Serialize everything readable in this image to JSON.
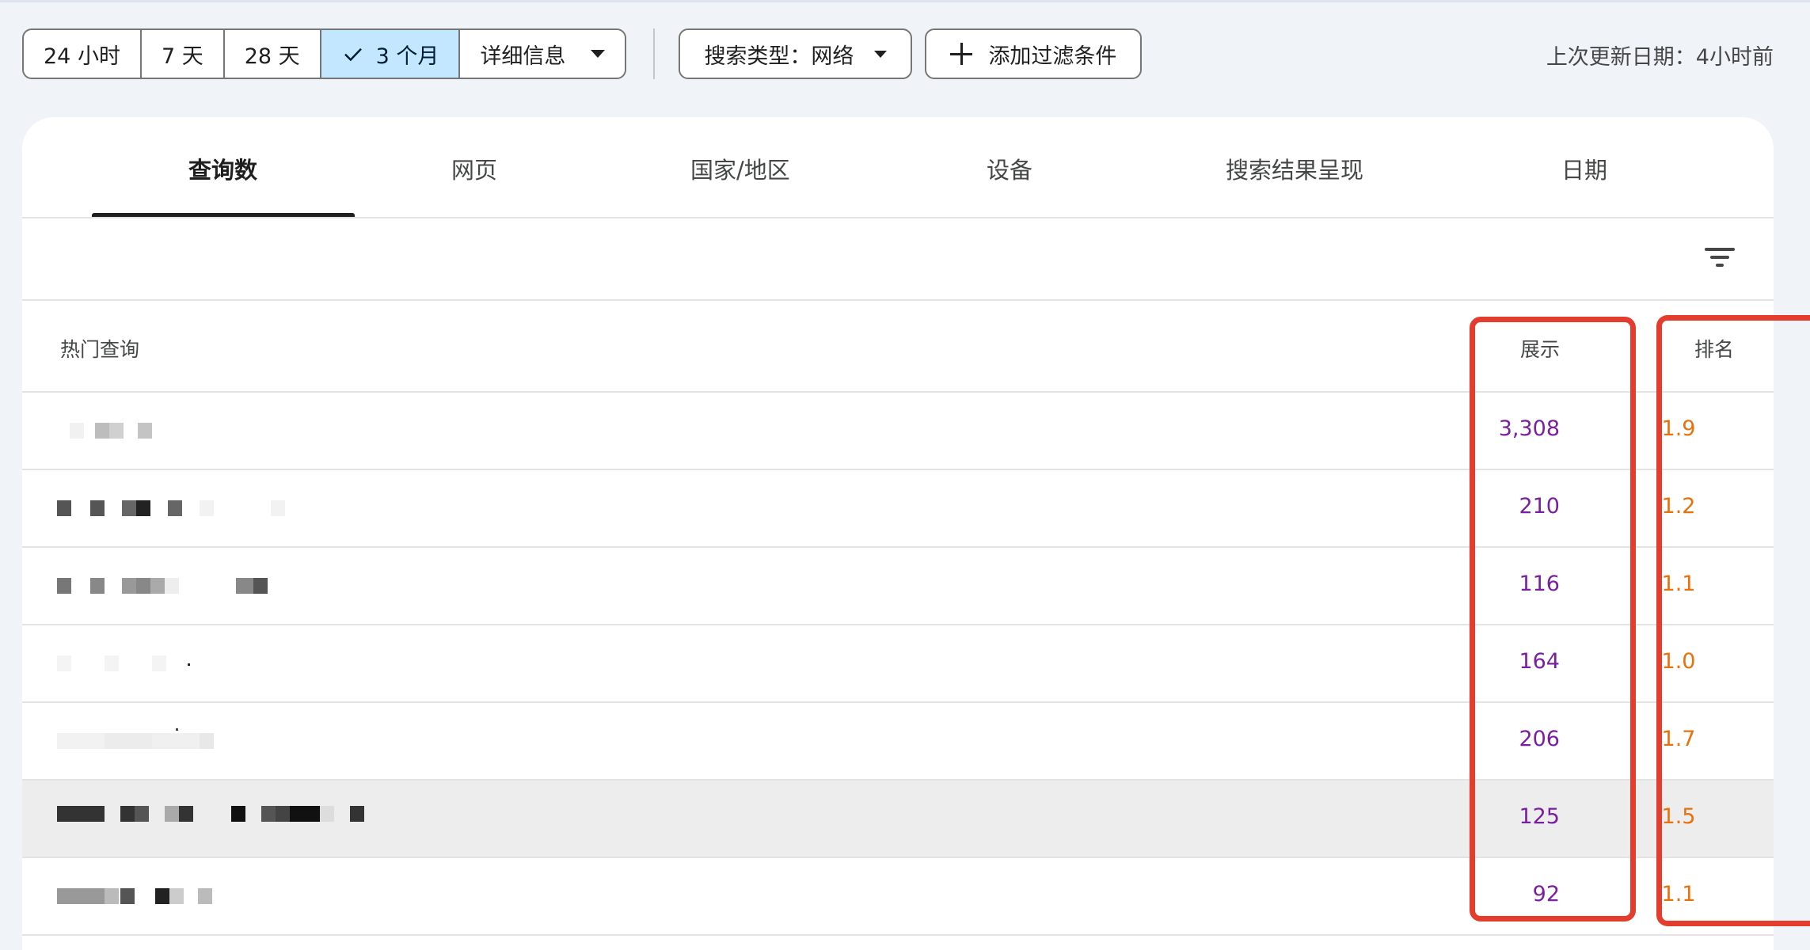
{
  "date_range": {
    "options": [
      "24 小时",
      "7 天",
      "28 天",
      "3 个月",
      "详细信息"
    ],
    "selected": "3 个月"
  },
  "search_type": {
    "label": "搜索类型：网络"
  },
  "add_filter": {
    "label": "添加过滤条件"
  },
  "last_updated": "上次更新日期：4小时前",
  "tabs": [
    {
      "label": "查询数",
      "active": true
    },
    {
      "label": "网页"
    },
    {
      "label": "国家/地区"
    },
    {
      "label": "设备"
    },
    {
      "label": "搜索结果呈现"
    },
    {
      "label": "日期"
    }
  ],
  "table": {
    "columns": {
      "query": "热门查询",
      "impressions": "展示",
      "position": "排名"
    },
    "rows": [
      {
        "impressions": "3,308",
        "position": "1.9"
      },
      {
        "impressions": "210",
        "position": "1.2"
      },
      {
        "impressions": "116",
        "position": "1.1"
      },
      {
        "impressions": "164",
        "position": "1.0"
      },
      {
        "impressions": "206",
        "position": "1.7"
      },
      {
        "impressions": "125",
        "position": "1.5"
      },
      {
        "impressions": "92",
        "position": "1.1"
      }
    ]
  },
  "colors": {
    "impressions_text": "#7b1fa2",
    "position_text": "#e8710a",
    "selected_chip_bg": "#c2e7ff",
    "highlight_box": "#e53d2d",
    "page_bg": "#f0f4f9"
  },
  "icons": [
    "check-icon",
    "dropdown-caret-icon",
    "plus-icon",
    "filter-list-icon"
  ]
}
